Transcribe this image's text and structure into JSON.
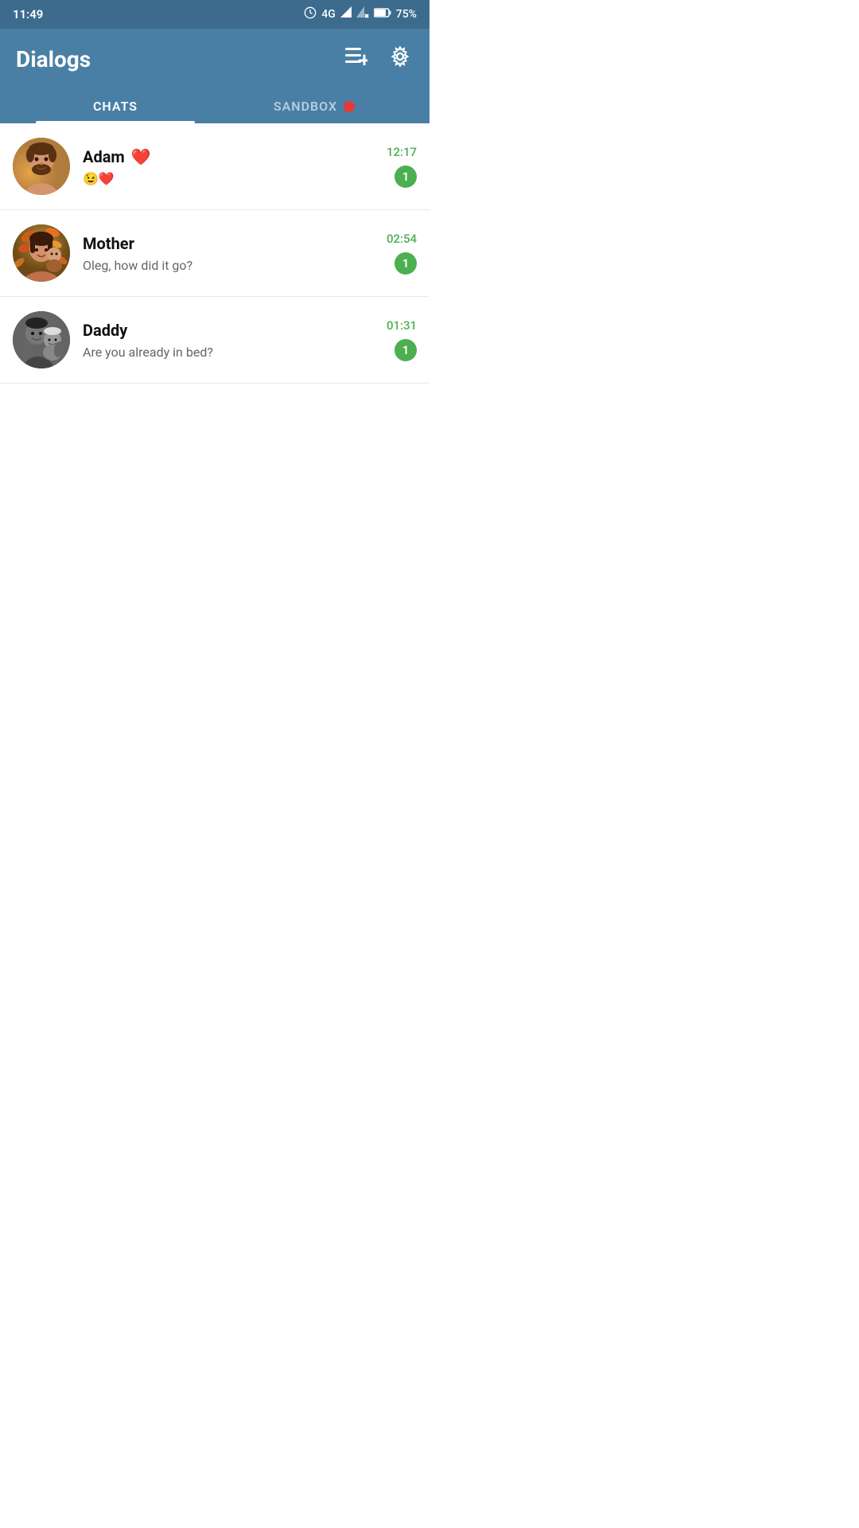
{
  "statusBar": {
    "time": "11:49",
    "network": "4G",
    "battery": "75%"
  },
  "header": {
    "title": "Dialogs",
    "addChatLabel": "add-chat",
    "settingsLabel": "settings"
  },
  "tabs": [
    {
      "id": "chats",
      "label": "CHATS",
      "active": true
    },
    {
      "id": "sandbox",
      "label": "SANDBOX",
      "active": false,
      "hasDot": true
    }
  ],
  "chats": [
    {
      "id": 1,
      "name": "Adam",
      "nameEmoji": "❤️",
      "preview": "😉❤️",
      "time": "12:17",
      "unread": 1,
      "avatarType": "adam"
    },
    {
      "id": 2,
      "name": "Mother",
      "nameEmoji": "",
      "preview": "Oleg, how did it go?",
      "time": "02:54",
      "unread": 1,
      "avatarType": "mother"
    },
    {
      "id": 3,
      "name": "Daddy",
      "nameEmoji": "",
      "preview": "Are you already in bed?",
      "time": "01:31",
      "unread": 1,
      "avatarType": "daddy"
    }
  ],
  "colors": {
    "headerBg": "#4a7fa5",
    "statusBarBg": "#3d6b8e",
    "activeTab": "#ffffff",
    "inactiveTab": "rgba(255,255,255,0.6)",
    "unreadBg": "#4caf50",
    "sandboxDot": "#e53935",
    "timeColor": "#4caf50"
  }
}
